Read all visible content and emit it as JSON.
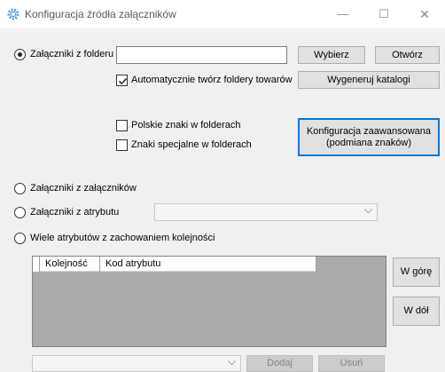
{
  "window": {
    "title": "Konfiguracja źródła załączników",
    "icon": "gear-icon",
    "controls": {
      "minimize": "—",
      "maximize": "☐",
      "close": "✕"
    }
  },
  "folder_option": {
    "label": "Załączniki z folderu",
    "selected": true,
    "path_value": "",
    "browse_button": "Wybierz",
    "open_button": "Otwórz"
  },
  "auto_create": {
    "label": "Automatycznie twórz foldery towarów",
    "checked": true
  },
  "generate_button": "Wygeneruj katalogi",
  "polish_chars": {
    "label": "Polskie znaki w folderach",
    "checked": false
  },
  "special_chars": {
    "label": "Znaki specjalne w folderach",
    "checked": false
  },
  "advanced_button": {
    "line1": "Konfiguracja zaawansowana",
    "line2": "(podmiana znaków)"
  },
  "attachments_option": {
    "label": "Załączniki z załączników",
    "selected": false
  },
  "attribute_option": {
    "label": "Załączniki z atrybutu",
    "selected": false,
    "value": ""
  },
  "multi_attribute_option": {
    "label": "Wiele atrybutów z zachowaniem kolejności",
    "selected": false
  },
  "grid": {
    "columns": [
      "Kolejność",
      "Kod atrybutu"
    ],
    "rows": []
  },
  "move_up_button": "W górę",
  "move_down_button": "W dół",
  "bottom": {
    "select_value": "",
    "add_button": "Dodaj",
    "remove_button": "Usuń"
  },
  "colors": {
    "accent": "#0078d7",
    "window_bg": "#f0f0f0",
    "grid_bg": "#aaaaaa"
  }
}
